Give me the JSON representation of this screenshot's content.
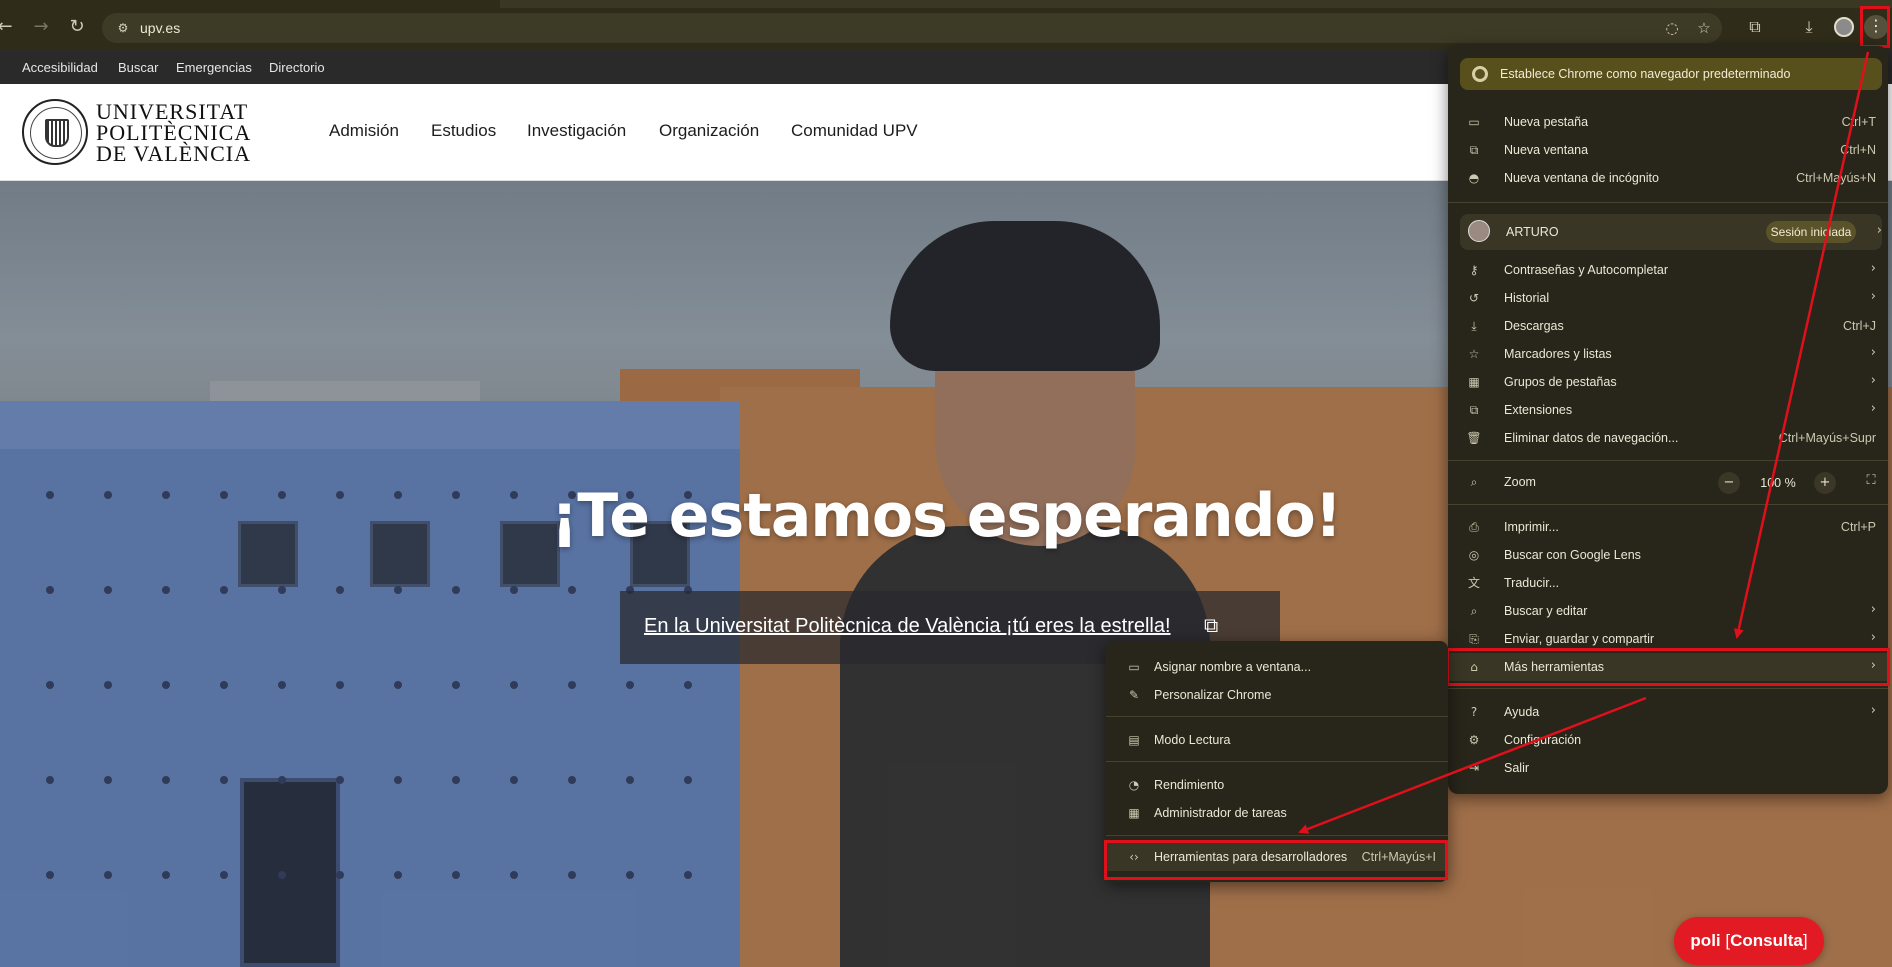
{
  "browser": {
    "url": "upv.es",
    "nav_back_icon": "arrow-left",
    "nav_forward_icon": "arrow-right",
    "reload_icon": "reload"
  },
  "site": {
    "utility_links": [
      "Accesibilidad",
      "Buscar",
      "Emergencias",
      "Directorio"
    ],
    "logo_lines": [
      "UNIVERSITAT",
      "POLITÈCNICA",
      "DE VALÈNCIA"
    ],
    "nav": [
      "Admisión",
      "Estudios",
      "Investigación",
      "Organización",
      "Comunidad UPV"
    ],
    "hero_title": "¡Te estamos esperando!",
    "hero_link": "En la Universitat Politècnica de València ¡tú eres la estrella!",
    "chat_button": {
      "prefix": "poli",
      "bracket_open": "[",
      "label": "Consulta",
      "bracket_close": "]"
    }
  },
  "chrome_menu": {
    "banner": "Establece Chrome como navegador predeterminado",
    "group1": [
      {
        "label": "Nueva pestaña",
        "shortcut": "Ctrl+T",
        "icon": "new-tab-icon"
      },
      {
        "label": "Nueva ventana",
        "shortcut": "Ctrl+N",
        "icon": "new-window-icon"
      },
      {
        "label": "Nueva ventana de incógnito",
        "shortcut": "Ctrl+Mayús+N",
        "icon": "incognito-icon"
      }
    ],
    "profile": {
      "name": "ARTURO",
      "status": "Sesión iniciada"
    },
    "group2": [
      {
        "label": "Contraseñas y Autocompletar",
        "icon": "key-icon"
      },
      {
        "label": "Historial",
        "icon": "history-icon"
      },
      {
        "label": "Descargas",
        "shortcut": "Ctrl+J",
        "icon": "download-icon"
      },
      {
        "label": "Marcadores y listas",
        "icon": "star-icon"
      },
      {
        "label": "Grupos de pestañas",
        "icon": "tab-groups-icon"
      },
      {
        "label": "Extensiones",
        "icon": "extensions-icon"
      },
      {
        "label": "Eliminar datos de navegación...",
        "shortcut": "Ctrl+Mayús+Supr",
        "icon": "trash-icon"
      }
    ],
    "zoom": {
      "label": "Zoom",
      "minus": "−",
      "value": "100 %",
      "plus": "+"
    },
    "group3": [
      {
        "label": "Imprimir...",
        "shortcut": "Ctrl+P",
        "icon": "print-icon"
      },
      {
        "label": "Buscar con Google Lens",
        "icon": "lens-icon"
      },
      {
        "label": "Traducir...",
        "icon": "translate-icon"
      },
      {
        "label": "Buscar y editar",
        "icon": "find-icon"
      },
      {
        "label": "Enviar, guardar y compartir",
        "icon": "share-icon"
      },
      {
        "label": "Más herramientas",
        "icon": "toolbox-icon"
      }
    ],
    "group4": [
      {
        "label": "Ayuda",
        "icon": "help-icon"
      },
      {
        "label": "Configuración",
        "icon": "settings-icon"
      },
      {
        "label": "Salir",
        "icon": "exit-icon"
      }
    ]
  },
  "submenu": {
    "items": [
      {
        "label": "Asignar nombre a ventana...",
        "icon": "window-name-icon"
      },
      {
        "label": "Personalizar Chrome",
        "icon": "pencil-icon"
      },
      {
        "label": "Modo Lectura",
        "icon": "reader-icon"
      },
      {
        "label": "Rendimiento",
        "icon": "performance-icon"
      },
      {
        "label": "Administrador de tareas",
        "icon": "task-manager-icon"
      },
      {
        "label": "Herramientas para desarrolladores",
        "shortcut": "Ctrl+Mayús+I",
        "icon": "code-icon"
      }
    ]
  },
  "colors": {
    "annotation_red": "#e0101b",
    "chrome_frame": "#2f2c1a",
    "menu_bg": "#28251a",
    "chat_red": "#e11a23"
  }
}
